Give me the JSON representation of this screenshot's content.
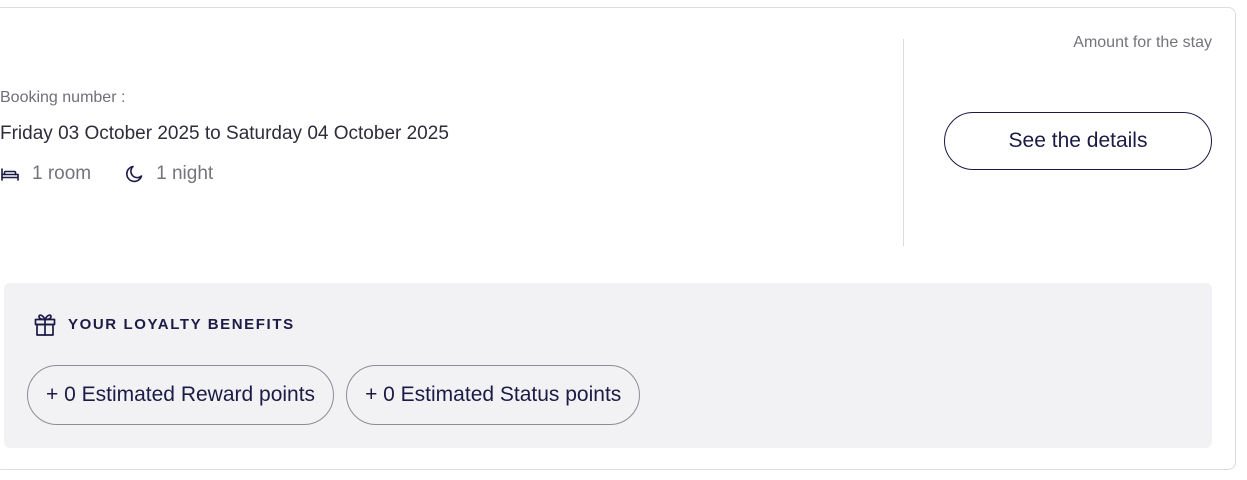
{
  "booking": {
    "number_label": "Booking number :",
    "dates": "Friday 03 October 2025 to Saturday 04 October 2025",
    "rooms": "1 room",
    "nights": "1 night"
  },
  "amount": {
    "label": "Amount for the stay"
  },
  "actions": {
    "details_label": "See the details"
  },
  "loyalty": {
    "title": "YOUR LOYALTY BENEFITS",
    "reward_points": "+ 0 Estimated Reward points",
    "status_points": "+ 0 Estimated Status points"
  },
  "icons": {
    "rooms": "bed-icon",
    "nights": "moon-icon",
    "loyalty": "gift-icon"
  },
  "colors": {
    "navy": "#1b1b45",
    "muted_text": "#74747c",
    "panel_bg": "#f2f2f5",
    "border": "#dcdce0"
  }
}
